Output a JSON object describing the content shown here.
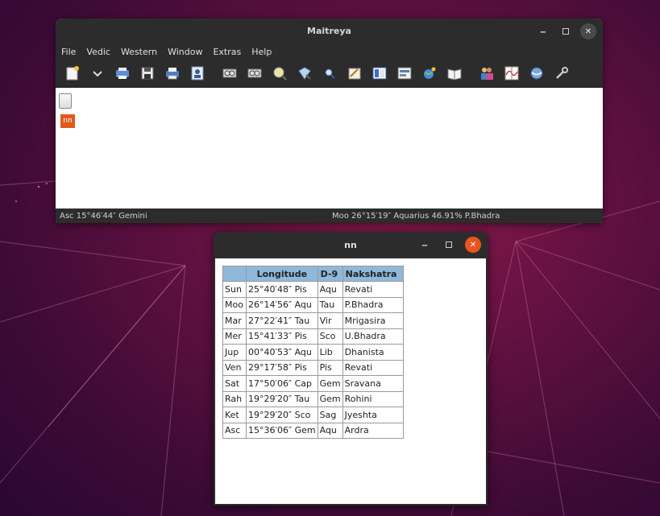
{
  "main_window": {
    "title": "Maitreya",
    "menu": [
      "File",
      "Vedic",
      "Western",
      "Window",
      "Extras",
      "Help"
    ],
    "toolbar_icons": [
      "new-chart-icon",
      "dropdown-chevron-icon",
      "print-icon",
      "save-icon",
      "printer-icon",
      "transit-icon",
      "chart-icon-1",
      "chart-icon-2",
      "search-icon",
      "gemstone-icon",
      "zoom-icon",
      "edit-icon",
      "table-icon",
      "panel-icon",
      "globe-icon",
      "book-icon",
      "partner-icon",
      "graph-icon",
      "world-icon",
      "tools-icon"
    ],
    "child_label": "nn",
    "status_left": "Asc 15°46′44″ Gemini",
    "status_right": "Moo 26°15′19″ Aquarius 46.91% P.Bhadra"
  },
  "nn_window": {
    "title": "nn",
    "headers": [
      "",
      "Longitude",
      "D-9",
      "Nakshatra"
    ],
    "rows": [
      [
        "Sun",
        "25°40′48″ Pis",
        "Aqu",
        "Revati"
      ],
      [
        "Moo",
        "26°14′56″ Aqu",
        "Tau",
        "P.Bhadra"
      ],
      [
        "Mar",
        "27°22′41″ Tau",
        "Vir",
        "Mrigasira"
      ],
      [
        "Mer",
        "15°41′33″ Pis",
        "Sco",
        "U.Bhadra"
      ],
      [
        "Jup",
        "00°40′53″ Aqu",
        "Lib",
        "Dhanista"
      ],
      [
        "Ven",
        "29°17′58″ Pis",
        "Pis",
        "Revati"
      ],
      [
        "Sat",
        "17°50′06″ Cap",
        "Gem",
        "Sravana"
      ],
      [
        "Rah",
        "19°29′20″ Tau",
        "Gem",
        "Rohini"
      ],
      [
        "Ket",
        "19°29′20″ Sco",
        "Sag",
        "Jyeshta"
      ],
      [
        "Asc",
        "15°36′06″ Gem",
        "Aqu",
        "Ardra"
      ]
    ]
  },
  "colors": {
    "titlebar": "#2c2c2c",
    "close_accent": "#e95420",
    "table_header": "#8fb8da",
    "nn_badge": "#e05a1e"
  }
}
